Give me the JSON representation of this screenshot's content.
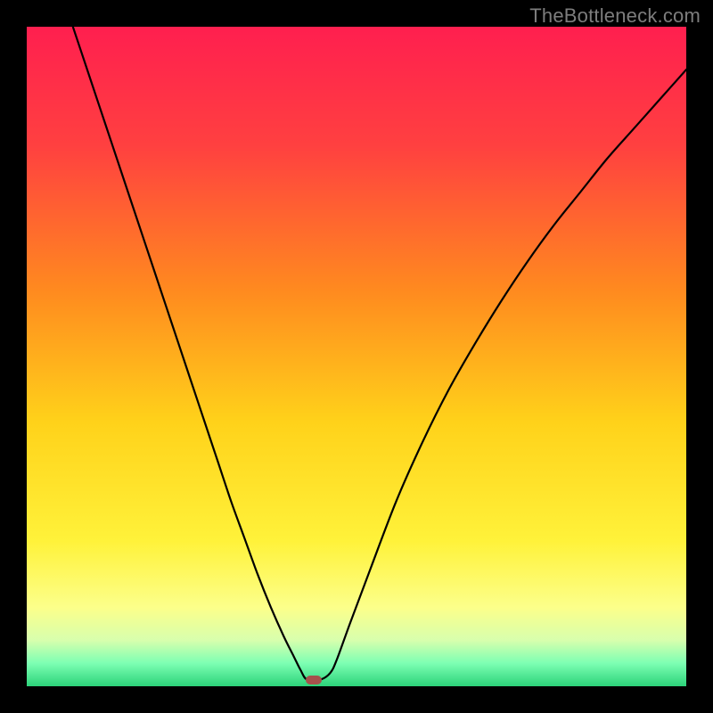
{
  "watermark_text": "TheBottleneck.com",
  "chart_data": {
    "type": "line",
    "title": "",
    "xlabel": "",
    "ylabel": "",
    "xlim": [
      0,
      1
    ],
    "ylim": [
      0,
      1
    ],
    "background_gradient_stops": [
      {
        "offset": 0.0,
        "color": "#ff1f4f"
      },
      {
        "offset": 0.18,
        "color": "#ff4040"
      },
      {
        "offset": 0.4,
        "color": "#ff8a1f"
      },
      {
        "offset": 0.6,
        "color": "#ffd21a"
      },
      {
        "offset": 0.78,
        "color": "#fff23a"
      },
      {
        "offset": 0.88,
        "color": "#fcff8a"
      },
      {
        "offset": 0.93,
        "color": "#d8ffad"
      },
      {
        "offset": 0.965,
        "color": "#7dffb3"
      },
      {
        "offset": 1.0,
        "color": "#2cd37a"
      }
    ],
    "series": [
      {
        "name": "bottleneck-curve",
        "x": [
          0.07,
          0.09,
          0.11,
          0.13,
          0.15,
          0.17,
          0.19,
          0.21,
          0.23,
          0.25,
          0.27,
          0.29,
          0.31,
          0.33,
          0.35,
          0.37,
          0.39,
          0.405,
          0.415,
          0.425,
          0.445,
          0.46,
          0.47,
          0.49,
          0.52,
          0.56,
          0.6,
          0.64,
          0.68,
          0.72,
          0.76,
          0.8,
          0.84,
          0.88,
          0.92,
          0.96,
          1.0
        ],
        "y": [
          1.0,
          0.94,
          0.88,
          0.82,
          0.76,
          0.7,
          0.64,
          0.58,
          0.52,
          0.46,
          0.4,
          0.34,
          0.28,
          0.225,
          0.17,
          0.12,
          0.075,
          0.045,
          0.025,
          0.01,
          0.01,
          0.02,
          0.04,
          0.095,
          0.175,
          0.28,
          0.37,
          0.45,
          0.52,
          0.585,
          0.645,
          0.7,
          0.75,
          0.8,
          0.845,
          0.89,
          0.935
        ]
      }
    ],
    "marker": {
      "x": 0.435,
      "y": 0.01,
      "color": "#a6514c"
    }
  }
}
